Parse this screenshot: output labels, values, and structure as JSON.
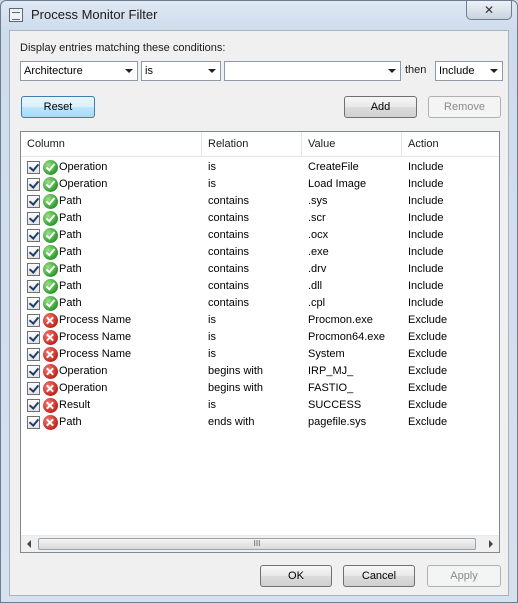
{
  "window": {
    "title": "Process Monitor Filter",
    "close_label": "✕"
  },
  "condition": {
    "label": "Display entries matching these conditions:",
    "column": "Architecture",
    "relation": "is",
    "value": "",
    "then_label": "then",
    "action": "Include"
  },
  "buttons": {
    "reset": "Reset",
    "add": "Add",
    "remove": "Remove",
    "ok": "OK",
    "cancel": "Cancel",
    "apply": "Apply"
  },
  "list": {
    "headers": [
      "Column",
      "Relation",
      "Value",
      "Action"
    ],
    "rows": [
      {
        "column": "Operation",
        "relation": "is",
        "value": "CreateFile",
        "action": "Include",
        "type": "include"
      },
      {
        "column": "Operation",
        "relation": "is",
        "value": "Load Image",
        "action": "Include",
        "type": "include"
      },
      {
        "column": "Path",
        "relation": "contains",
        "value": ".sys",
        "action": "Include",
        "type": "include"
      },
      {
        "column": "Path",
        "relation": "contains",
        "value": ".scr",
        "action": "Include",
        "type": "include"
      },
      {
        "column": "Path",
        "relation": "contains",
        "value": ".ocx",
        "action": "Include",
        "type": "include"
      },
      {
        "column": "Path",
        "relation": "contains",
        "value": ".exe",
        "action": "Include",
        "type": "include"
      },
      {
        "column": "Path",
        "relation": "contains",
        "value": ".drv",
        "action": "Include",
        "type": "include"
      },
      {
        "column": "Path",
        "relation": "contains",
        "value": ".dll",
        "action": "Include",
        "type": "include"
      },
      {
        "column": "Path",
        "relation": "contains",
        "value": ".cpl",
        "action": "Include",
        "type": "include"
      },
      {
        "column": "Process Name",
        "relation": "is",
        "value": "Procmon.exe",
        "action": "Exclude",
        "type": "exclude"
      },
      {
        "column": "Process Name",
        "relation": "is",
        "value": "Procmon64.exe",
        "action": "Exclude",
        "type": "exclude"
      },
      {
        "column": "Process Name",
        "relation": "is",
        "value": "System",
        "action": "Exclude",
        "type": "exclude"
      },
      {
        "column": "Operation",
        "relation": "begins with",
        "value": "IRP_MJ_",
        "action": "Exclude",
        "type": "exclude"
      },
      {
        "column": "Operation",
        "relation": "begins with",
        "value": "FASTIO_",
        "action": "Exclude",
        "type": "exclude"
      },
      {
        "column": "Result",
        "relation": "is",
        "value": "SUCCESS",
        "action": "Exclude",
        "type": "exclude"
      },
      {
        "column": "Path",
        "relation": "ends with",
        "value": "pagefile.sys",
        "action": "Exclude",
        "type": "exclude"
      }
    ],
    "scroll_grip": "III"
  }
}
